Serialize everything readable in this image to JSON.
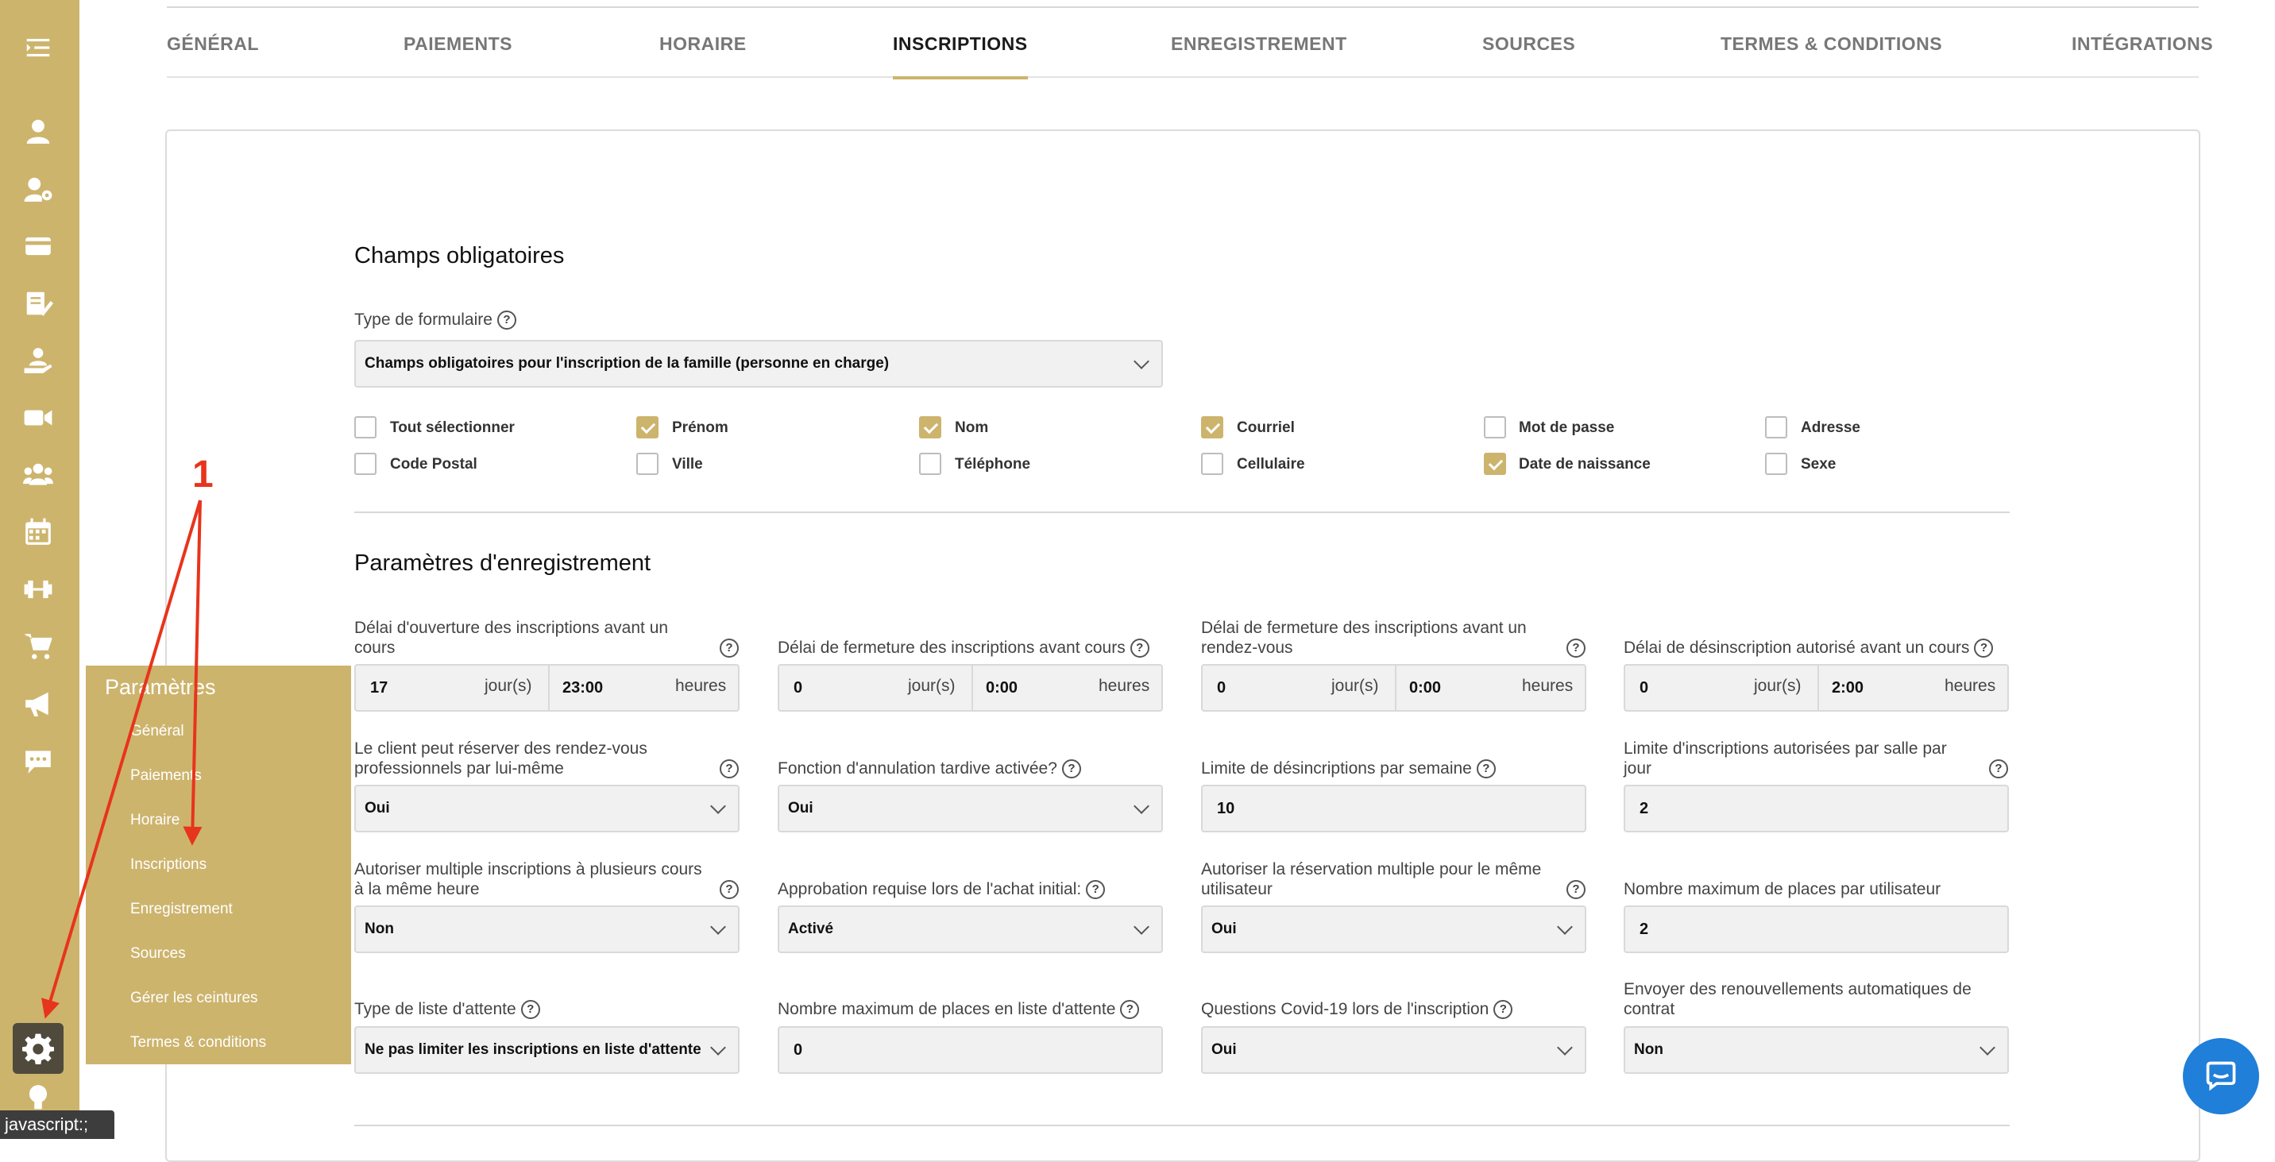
{
  "tabs": [
    {
      "label": "GÉNÉRAL",
      "active": false
    },
    {
      "label": "PAIEMENTS",
      "active": false
    },
    {
      "label": "HORAIRE",
      "active": false
    },
    {
      "label": "INSCRIPTIONS",
      "active": true
    },
    {
      "label": "ENREGISTREMENT",
      "active": false
    },
    {
      "label": "SOURCES",
      "active": false
    },
    {
      "label": "TERMES & CONDITIONS",
      "active": false
    },
    {
      "label": "INTÉGRATIONS",
      "active": false
    }
  ],
  "sidebar_icons": [
    "menu-icon",
    "user-icon",
    "user-gear-icon",
    "credit-card-icon",
    "edit-document-icon",
    "hand-user-icon",
    "video-camera-icon",
    "users-group-icon",
    "calendar-icon",
    "dumbbell-icon",
    "shopping-cart-icon",
    "megaphone-icon",
    "chat-bubble-icon",
    "settings-gear-icon",
    "lightbulb-icon"
  ],
  "required_fields": {
    "title": "Champs obligatoires",
    "form_type_label": "Type de formulaire",
    "form_type_value": "Champs obligatoires pour l'inscription de la famille (personne en charge)",
    "checkboxes": [
      {
        "label": "Tout sélectionner",
        "checked": false
      },
      {
        "label": "Prénom",
        "checked": true
      },
      {
        "label": "Nom",
        "checked": true
      },
      {
        "label": "Courriel",
        "checked": true
      },
      {
        "label": "Mot de passe",
        "checked": false
      },
      {
        "label": "Adresse",
        "checked": false
      },
      {
        "label": "Code Postal",
        "checked": false
      },
      {
        "label": "Ville",
        "checked": false
      },
      {
        "label": "Téléphone",
        "checked": false
      },
      {
        "label": "Cellulaire",
        "checked": false
      },
      {
        "label": "Date de naissance",
        "checked": true
      },
      {
        "label": "Sexe",
        "checked": false
      }
    ]
  },
  "registration_params": {
    "title": "Paramètres d'enregistrement",
    "row1": [
      {
        "label": "Délai d'ouverture des inscriptions avant un cours",
        "days": "17",
        "days_unit": "jour(s)",
        "hours": "23:00",
        "hours_unit": "heures"
      },
      {
        "label": "Délai de fermeture des inscriptions avant cours",
        "days": "0",
        "days_unit": "jour(s)",
        "hours": "0:00",
        "hours_unit": "heures"
      },
      {
        "label": "Délai de fermeture des inscriptions avant un rendez-vous",
        "days": "0",
        "days_unit": "jour(s)",
        "hours": "0:00",
        "hours_unit": "heures"
      },
      {
        "label": "Délai de désinscription autorisé avant un cours",
        "days": "0",
        "days_unit": "jour(s)",
        "hours": "2:00",
        "hours_unit": "heures"
      }
    ],
    "row2": [
      {
        "label": "Le client peut réserver des rendez-vous professionnels par lui-même",
        "value": "Oui",
        "kind": "select"
      },
      {
        "label": "Fonction d'annulation tardive activée?",
        "value": "Oui",
        "kind": "select"
      },
      {
        "label": "Limite de désincriptions par semaine",
        "value": "10",
        "kind": "input"
      },
      {
        "label": "Limite d'inscriptions autorisées par salle par jour",
        "value": "2",
        "kind": "input"
      }
    ],
    "row3": [
      {
        "label": "Autoriser multiple inscriptions à plusieurs cours à la même heure",
        "value": "Non",
        "kind": "select"
      },
      {
        "label": "Approbation requise lors de l'achat initial:",
        "value": "Activé",
        "kind": "select"
      },
      {
        "label": "Autoriser la réservation multiple pour le même utilisateur",
        "value": "Oui",
        "kind": "select"
      },
      {
        "label": "Nombre maximum de places par utilisateur",
        "value": "2",
        "kind": "input"
      }
    ],
    "row4": [
      {
        "label": "Type de liste d'attente",
        "value": "Ne pas limiter les inscriptions en liste d'attente",
        "kind": "select"
      },
      {
        "label": "Nombre maximum de places en liste d'attente",
        "value": "0",
        "kind": "input"
      },
      {
        "label": "Questions Covid-19 lors de l'inscription",
        "value": "Oui",
        "kind": "select"
      },
      {
        "label": "Envoyer des renouvellements automatiques de contrat",
        "value": "Non",
        "kind": "select"
      }
    ]
  },
  "flyout": {
    "title": "Paramètres",
    "items": [
      "Général",
      "Paiements",
      "Horaire",
      "Inscriptions",
      "Enregistrement",
      "Sources",
      "Gérer les ceintures",
      "Termes & conditions"
    ]
  },
  "status_tooltip": "javascript:;",
  "annotation": {
    "number": "1",
    "color": "#e8341c"
  },
  "colors": {
    "accent": "#cdb46d",
    "chat": "#1f7fd9"
  }
}
